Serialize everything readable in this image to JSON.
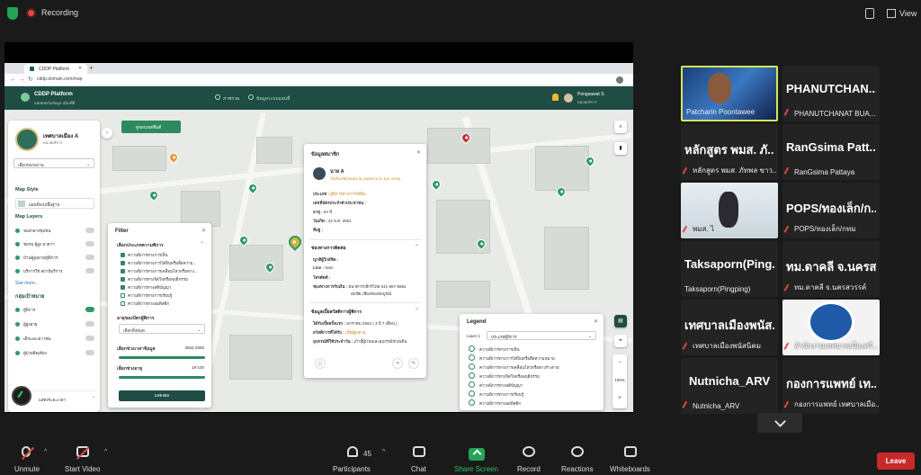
{
  "zoom": {
    "recording_label": "Recording",
    "view_label": "View",
    "toolbar": {
      "unmute": "Unmute",
      "start_video": "Start Video",
      "participants": "Participants",
      "participants_count": "45",
      "chat": "Chat",
      "share_screen": "Share Screen",
      "record": "Record",
      "reactions": "Reactions",
      "whiteboards": "Whiteboards",
      "leave": "Leave"
    }
  },
  "gallery": [
    {
      "big": "",
      "name": "Patcharin Poontawee",
      "muted": false,
      "active": true
    },
    {
      "big": "PHANUTCHAN...",
      "name": "PHANUTCHANAT BUA...",
      "muted": true
    },
    {
      "big": "หลักสูตร พมส. ภั...",
      "name": "หลักสูตร พมส. ภัทพล ขาว...",
      "muted": true
    },
    {
      "big": "RanGsima  Patt...",
      "name": "RanGsima  Pattaya",
      "muted": true
    },
    {
      "big": "",
      "name": "พมส. ไ",
      "muted": true
    },
    {
      "big": "POPS/ทองเล็ก/ก...",
      "name": "POPS/ทองเล็ก/กทม",
      "muted": true
    },
    {
      "big": "Taksaporn(Ping...",
      "name": "Taksaporn(Pingping)",
      "muted": false
    },
    {
      "big": "ทม.ดาคลี จ.นครส...",
      "name": "ทม.ดาคลี จ.นครสวรรค์",
      "muted": true
    },
    {
      "big": "เทศบาลเมืองพนัส...",
      "name": "เทศบาลเมืองพนัสนิคม",
      "muted": true
    },
    {
      "big": "",
      "name": "สำนักงานเทศบาลเมืองศรี...",
      "muted": true
    },
    {
      "big": "Nutnicha_ARV",
      "name": "Nutnicha_ARV",
      "muted": true
    },
    {
      "big": "กองการแพทย์ เท...",
      "name": "กองการแพทย์ เทศบาลเมือ...",
      "muted": true
    }
  ],
  "browser": {
    "tab_title": "CDDP Platform",
    "url": "cddp.domain.com/map"
  },
  "app": {
    "title": "CDDP Platform",
    "subtitle": "แพลตฟอร์มข้อมูล เมืองที่ดี",
    "nav": [
      "ภาพรวม",
      "ข้อมูลระบบแผนที่"
    ],
    "user_name": "Pongsawat S.",
    "user_role": "หน่วยบริการ",
    "area_button": "ดูขอบเขตพื้นที่"
  },
  "left_panel": {
    "org_title": "เทศบาลเมือง A",
    "org_sub": "หน่วยบริการ",
    "org_select": "เลือกหน่วยงาน",
    "map_style_heading": "Map Style",
    "map_style_value": "แผนที่แบบพื้นฐาน",
    "map_layers_heading": "Map Layers",
    "layers": [
      "ของกลางชุมชน",
      "ชมรม ผู้สูง อาสาฯ",
      "บ้านผู้สูงอายุ/ผู้พิการ",
      "บริการให้ สถานีบริการ"
    ],
    "see_more": "See more...",
    "target_heading": "กลุ่มเป้าหมาย",
    "targets": [
      "ผู้พิการ",
      "ผู้สูงอายุ",
      "เด็กและเยาวชน",
      "ผู้ป่วยติดเตียง"
    ],
    "bottom_label": "แสดงระยะเวลา"
  },
  "filter": {
    "title": "Filter",
    "type_heading": "เลือกประเภทความพิการ",
    "types": [
      {
        "label": "ความพิการทางการเห็น",
        "checked": true
      },
      {
        "label": "ความพิการทางการได้ยินหรือสื่อความ...",
        "checked": true
      },
      {
        "label": "ความพิการทางการเคลื่อนไหวหรือทาง...",
        "checked": true
      },
      {
        "label": "ความพิการทางจิตใจหรือพฤติกรรม",
        "checked": true
      },
      {
        "label": "ความพิการทางสติปัญญา",
        "checked": true
      },
      {
        "label": "ความพิการทางการเรียนรู้",
        "checked": false
      },
      {
        "label": "ความพิการทางออทิสติก",
        "checked": false
      }
    ],
    "card_heading": "อายุของบัตรผู้พิการ",
    "card_select": "เลือกทั้งหมด",
    "period_heading": "เลือกช่วงเวลาข้อมูล",
    "period_value": "2562-2565",
    "age_heading": "เลือกช่วงอายุ",
    "age_value": "18-100",
    "apply": "แสดงผล"
  },
  "info": {
    "title": "ข้อมูลสมาชิก",
    "name": "นาย A",
    "note": "ได้เลือกบัตรหมดอายุ (หมดอายุ 22 พ.ค. 2565)",
    "fields": [
      {
        "k": "ประเภท :",
        "v": "ผู้พิการทางการได้ยิน"
      },
      {
        "k": "เลขที่บัตรประจำตัวประชาชน :",
        "v": ""
      },
      {
        "k": "อายุ :",
        "v": "64 ปี"
      },
      {
        "k": "วันเกิด :",
        "v": "22 พ.ค. 2501"
      },
      {
        "k": "ที่อยู่ :",
        "v": ""
      }
    ],
    "contact_heading": "ช่องทางการติดต่อ",
    "contact": [
      {
        "k": "ญาติผู้ใกล้ชิด :",
        "v": ""
      },
      {
        "k": "Line :",
        "v": "Sam"
      },
      {
        "k": "โทรศัพท์ :",
        "v": ""
      },
      {
        "k": "ช่องทางการรับเงิน :",
        "v": "ธนาคารกสิกรไทย 541-897-6854"
      },
      {
        "k": "",
        "v": "สมชัย เชียงทองสมบูรณ์"
      }
    ],
    "welfare_heading": "ข้อมูลเบี้ยสวัสดิการผู้พิการ",
    "welfare": [
      {
        "k": "ได้รับเบี้ยครั้งแรก :",
        "v": "มกราคม 2562 ( 3 ปี 7 เดือน )"
      },
      {
        "k": "สวัสดิการที่ได้รับ :",
        "v": "เบี้ยผู้สูงอายุ"
      },
      {
        "k": "อุปกรณ์ที่ใช้ประจำวัน :",
        "v": "เก้าอี้ผู้ป่วยและอุปกรณ์ช่วยเดิน"
      }
    ]
  },
  "legend": {
    "title": "Legend",
    "layer_label": "Layer 1",
    "layer_value": "ประเภทผู้พิการ",
    "items": [
      "ความพิการทางการเห็น",
      "ความพิการทางการได้ยินหรือสื่อความหมาย",
      "ความพิการทางการเคลื่อนไหวหรือทางร่างกาย",
      "ความพิการทางจิตใจหรือพฤติกรรม",
      "ความพิการทางสติปัญญา",
      "ความพิการทางการเรียนรู้",
      "ความพิการทางออทิสติก"
    ]
  },
  "map_tools": {
    "zoom_level": "100%"
  }
}
